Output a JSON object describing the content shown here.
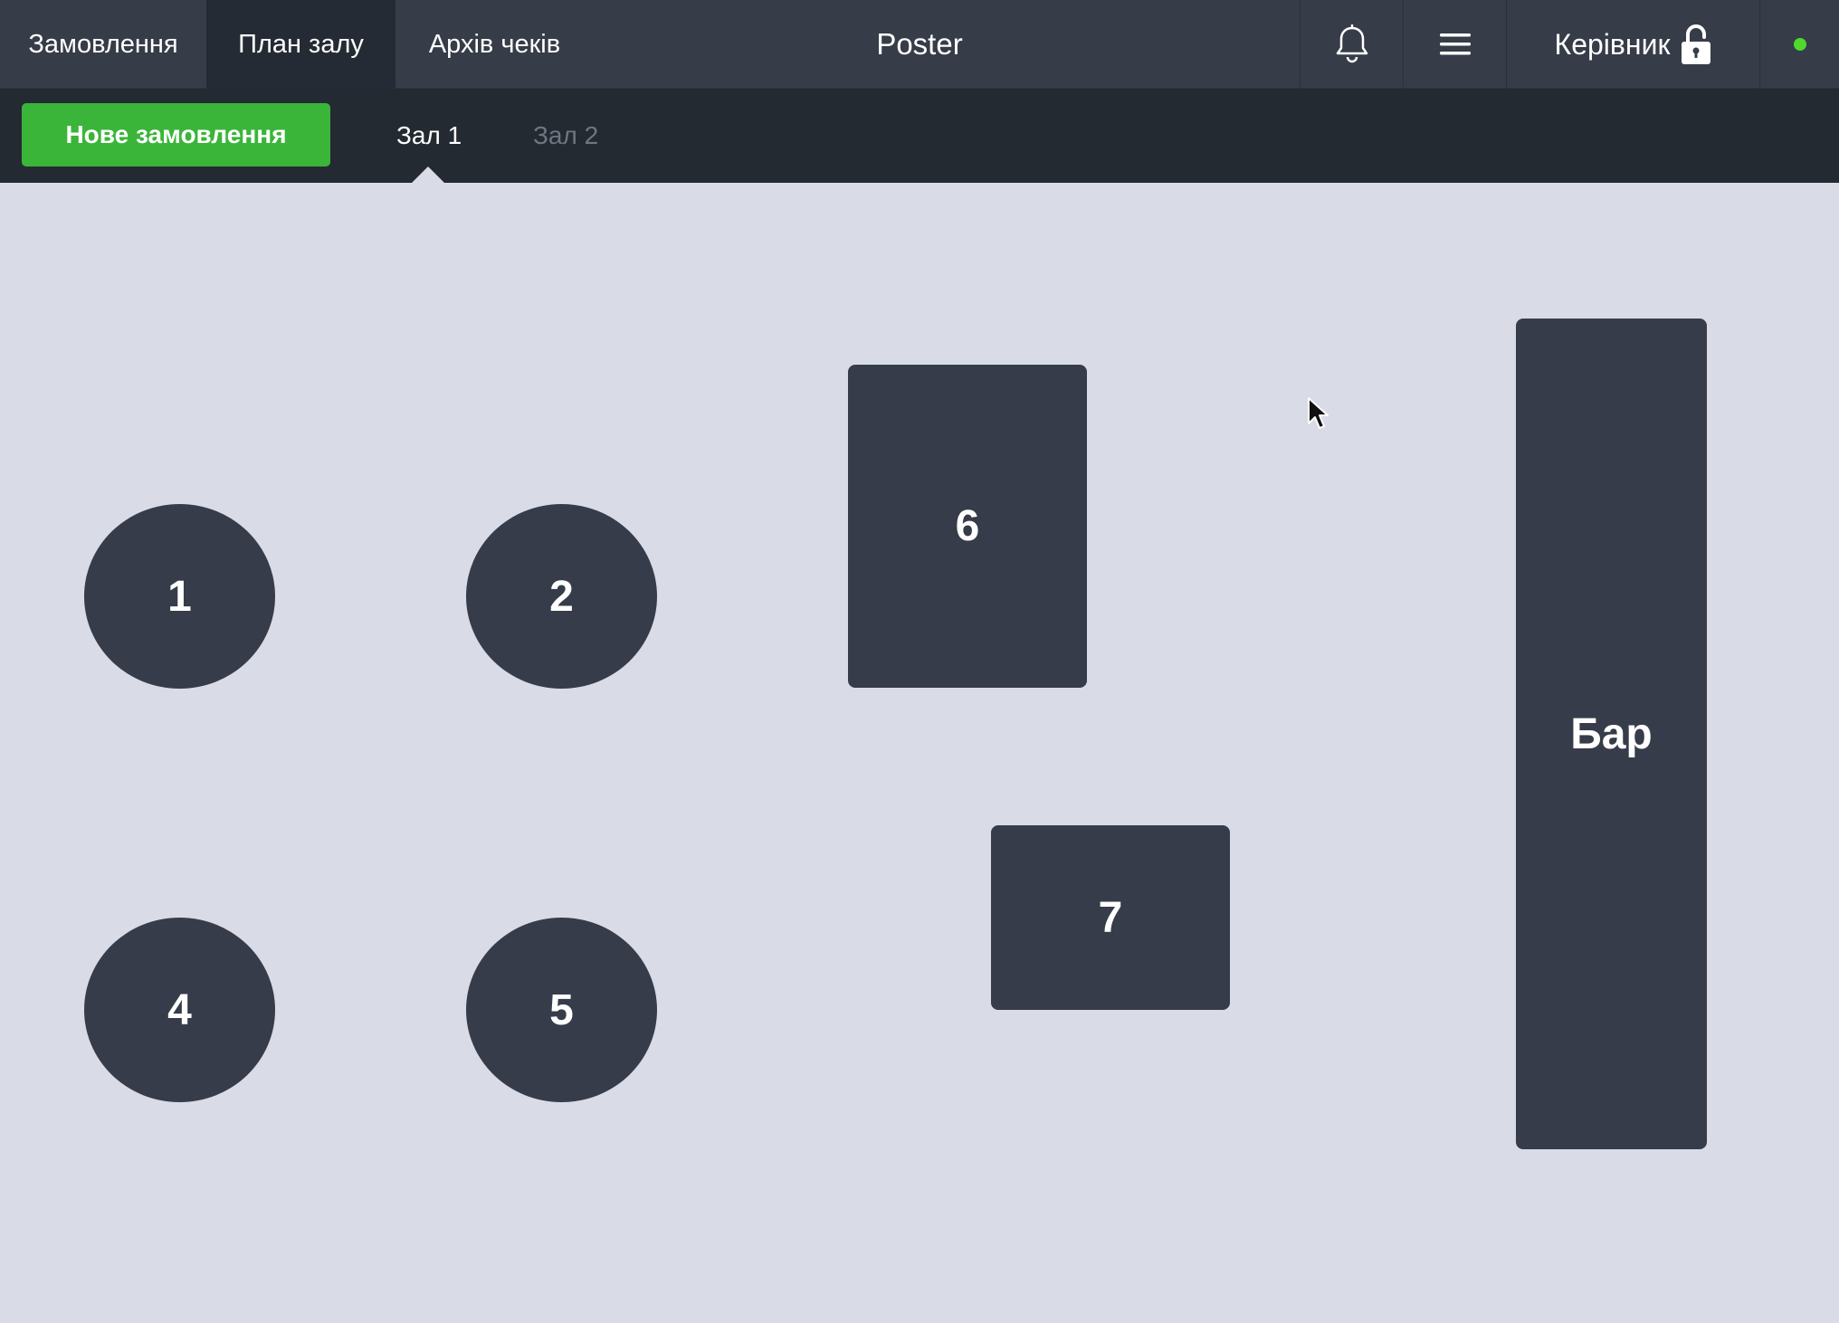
{
  "header": {
    "tabs": [
      {
        "label": "Замовлення",
        "active": false
      },
      {
        "label": "План залу",
        "active": true
      },
      {
        "label": "Архів чеків",
        "active": false
      }
    ],
    "app_title": "Poster",
    "user_label": "Керівник",
    "icons": {
      "notifications": "bell-icon",
      "menu": "hamburger-menu-icon",
      "user_lock": "unlocked-padlock-icon",
      "status": "online-status-dot"
    },
    "status_color": "#4fd82d"
  },
  "subheader": {
    "new_order_label": "Нове замовлення",
    "new_order_color": "#3ab53a",
    "halls": [
      {
        "label": "Зал 1",
        "active": true
      },
      {
        "label": "Зал 2",
        "active": false
      }
    ]
  },
  "floor": {
    "tables": [
      {
        "label": "1",
        "shape": "round"
      },
      {
        "label": "2",
        "shape": "round"
      },
      {
        "label": "4",
        "shape": "round"
      },
      {
        "label": "5",
        "shape": "round"
      },
      {
        "label": "6",
        "shape": "rectangle"
      },
      {
        "label": "7",
        "shape": "rectangle"
      },
      {
        "label": "Бар",
        "shape": "rectangle"
      }
    ],
    "table_color": "#363c49",
    "background_color": "#d9dbe6"
  }
}
